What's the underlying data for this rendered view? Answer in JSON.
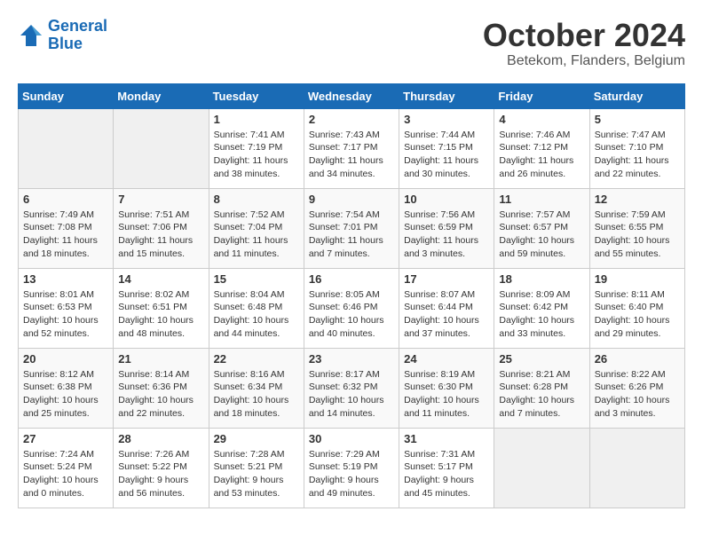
{
  "header": {
    "logo_line1": "General",
    "logo_line2": "Blue",
    "month": "October 2024",
    "location": "Betekom, Flanders, Belgium"
  },
  "days_of_week": [
    "Sunday",
    "Monday",
    "Tuesday",
    "Wednesday",
    "Thursday",
    "Friday",
    "Saturday"
  ],
  "weeks": [
    [
      {
        "day": "",
        "info": ""
      },
      {
        "day": "",
        "info": ""
      },
      {
        "day": "1",
        "info": "Sunrise: 7:41 AM\nSunset: 7:19 PM\nDaylight: 11 hours and 38 minutes."
      },
      {
        "day": "2",
        "info": "Sunrise: 7:43 AM\nSunset: 7:17 PM\nDaylight: 11 hours and 34 minutes."
      },
      {
        "day": "3",
        "info": "Sunrise: 7:44 AM\nSunset: 7:15 PM\nDaylight: 11 hours and 30 minutes."
      },
      {
        "day": "4",
        "info": "Sunrise: 7:46 AM\nSunset: 7:12 PM\nDaylight: 11 hours and 26 minutes."
      },
      {
        "day": "5",
        "info": "Sunrise: 7:47 AM\nSunset: 7:10 PM\nDaylight: 11 hours and 22 minutes."
      }
    ],
    [
      {
        "day": "6",
        "info": "Sunrise: 7:49 AM\nSunset: 7:08 PM\nDaylight: 11 hours and 18 minutes."
      },
      {
        "day": "7",
        "info": "Sunrise: 7:51 AM\nSunset: 7:06 PM\nDaylight: 11 hours and 15 minutes."
      },
      {
        "day": "8",
        "info": "Sunrise: 7:52 AM\nSunset: 7:04 PM\nDaylight: 11 hours and 11 minutes."
      },
      {
        "day": "9",
        "info": "Sunrise: 7:54 AM\nSunset: 7:01 PM\nDaylight: 11 hours and 7 minutes."
      },
      {
        "day": "10",
        "info": "Sunrise: 7:56 AM\nSunset: 6:59 PM\nDaylight: 11 hours and 3 minutes."
      },
      {
        "day": "11",
        "info": "Sunrise: 7:57 AM\nSunset: 6:57 PM\nDaylight: 10 hours and 59 minutes."
      },
      {
        "day": "12",
        "info": "Sunrise: 7:59 AM\nSunset: 6:55 PM\nDaylight: 10 hours and 55 minutes."
      }
    ],
    [
      {
        "day": "13",
        "info": "Sunrise: 8:01 AM\nSunset: 6:53 PM\nDaylight: 10 hours and 52 minutes."
      },
      {
        "day": "14",
        "info": "Sunrise: 8:02 AM\nSunset: 6:51 PM\nDaylight: 10 hours and 48 minutes."
      },
      {
        "day": "15",
        "info": "Sunrise: 8:04 AM\nSunset: 6:48 PM\nDaylight: 10 hours and 44 minutes."
      },
      {
        "day": "16",
        "info": "Sunrise: 8:05 AM\nSunset: 6:46 PM\nDaylight: 10 hours and 40 minutes."
      },
      {
        "day": "17",
        "info": "Sunrise: 8:07 AM\nSunset: 6:44 PM\nDaylight: 10 hours and 37 minutes."
      },
      {
        "day": "18",
        "info": "Sunrise: 8:09 AM\nSunset: 6:42 PM\nDaylight: 10 hours and 33 minutes."
      },
      {
        "day": "19",
        "info": "Sunrise: 8:11 AM\nSunset: 6:40 PM\nDaylight: 10 hours and 29 minutes."
      }
    ],
    [
      {
        "day": "20",
        "info": "Sunrise: 8:12 AM\nSunset: 6:38 PM\nDaylight: 10 hours and 25 minutes."
      },
      {
        "day": "21",
        "info": "Sunrise: 8:14 AM\nSunset: 6:36 PM\nDaylight: 10 hours and 22 minutes."
      },
      {
        "day": "22",
        "info": "Sunrise: 8:16 AM\nSunset: 6:34 PM\nDaylight: 10 hours and 18 minutes."
      },
      {
        "day": "23",
        "info": "Sunrise: 8:17 AM\nSunset: 6:32 PM\nDaylight: 10 hours and 14 minutes."
      },
      {
        "day": "24",
        "info": "Sunrise: 8:19 AM\nSunset: 6:30 PM\nDaylight: 10 hours and 11 minutes."
      },
      {
        "day": "25",
        "info": "Sunrise: 8:21 AM\nSunset: 6:28 PM\nDaylight: 10 hours and 7 minutes."
      },
      {
        "day": "26",
        "info": "Sunrise: 8:22 AM\nSunset: 6:26 PM\nDaylight: 10 hours and 3 minutes."
      }
    ],
    [
      {
        "day": "27",
        "info": "Sunrise: 7:24 AM\nSunset: 5:24 PM\nDaylight: 10 hours and 0 minutes."
      },
      {
        "day": "28",
        "info": "Sunrise: 7:26 AM\nSunset: 5:22 PM\nDaylight: 9 hours and 56 minutes."
      },
      {
        "day": "29",
        "info": "Sunrise: 7:28 AM\nSunset: 5:21 PM\nDaylight: 9 hours and 53 minutes."
      },
      {
        "day": "30",
        "info": "Sunrise: 7:29 AM\nSunset: 5:19 PM\nDaylight: 9 hours and 49 minutes."
      },
      {
        "day": "31",
        "info": "Sunrise: 7:31 AM\nSunset: 5:17 PM\nDaylight: 9 hours and 45 minutes."
      },
      {
        "day": "",
        "info": ""
      },
      {
        "day": "",
        "info": ""
      }
    ]
  ]
}
